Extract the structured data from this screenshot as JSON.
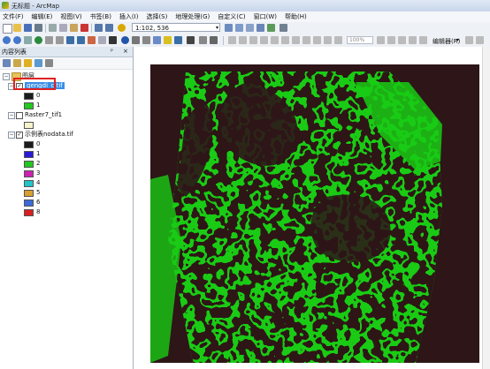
{
  "window": {
    "title": "无标题 - ArcMap"
  },
  "menu": [
    "文件(F)",
    "编辑(E)",
    "视图(V)",
    "书签(B)",
    "插入(I)",
    "选择(S)",
    "地理处理(G)",
    "自定义(C)",
    "窗口(W)",
    "帮助(H)"
  ],
  "toolbar": {
    "scale": "1:102, 536",
    "zoom_percent": "100%",
    "editor_label": "编辑器(R)"
  },
  "toc": {
    "title": "内容列表",
    "pin_glyph": "ᵖ",
    "close_glyph": "×",
    "root": "图层",
    "layers": [
      {
        "name": "gengdi_c.tif",
        "checked": true,
        "selected": true,
        "legend": [
          {
            "value": "0",
            "color": "#1c1c1c"
          },
          {
            "value": "1",
            "color": "#22c81e"
          }
        ]
      },
      {
        "name": "Raster7_tif1",
        "checked": false,
        "selected": false,
        "legend": [
          {
            "value": "",
            "color": "#f6f3cd"
          }
        ]
      },
      {
        "name": "示例表nodata.tif",
        "checked": true,
        "selected": false,
        "legend": [
          {
            "value": "0",
            "color": "#1c1c1c"
          },
          {
            "value": "1",
            "color": "#2a1ad6"
          },
          {
            "value": "2",
            "color": "#22c81e"
          },
          {
            "value": "3",
            "color": "#cc22b0"
          },
          {
            "value": "4",
            "color": "#22c4c8"
          },
          {
            "value": "5",
            "color": "#d8a030"
          },
          {
            "value": "6",
            "color": "#3a6ad8"
          },
          {
            "value": "8",
            "color": "#d82020"
          }
        ]
      }
    ]
  },
  "map": {
    "background_color": "#2d1518",
    "vegetation_color": "#19cb14"
  },
  "glyphs": {
    "checkmark": "✓",
    "expand": "−",
    "collapse": "+",
    "dropdown": "▾"
  }
}
